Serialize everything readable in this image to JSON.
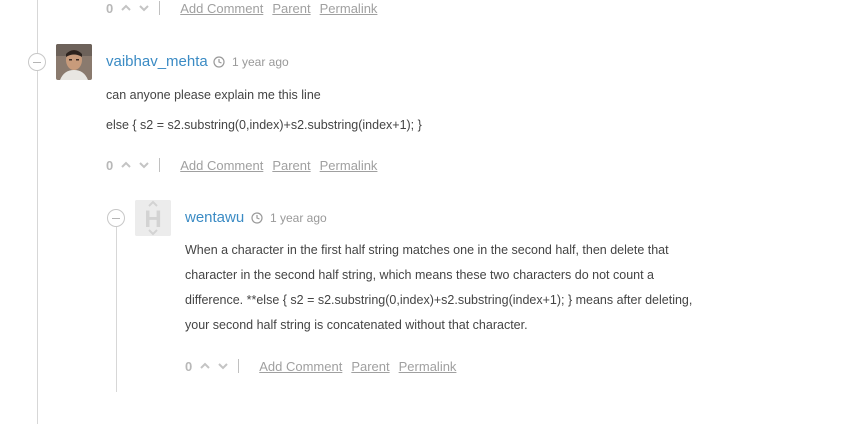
{
  "top_actions": {
    "count": "0",
    "add_comment": "Add Comment",
    "parent": "Parent",
    "permalink": "Permalink"
  },
  "comment1": {
    "author": "vaibhav_mehta",
    "time": "1 year ago",
    "line1": "can anyone please explain me this line",
    "line2": "else { s2 = s2.substring(0,index)+s2.substring(index+1); }",
    "actions": {
      "count": "0",
      "add_comment": "Add Comment",
      "parent": "Parent",
      "permalink": "Permalink"
    }
  },
  "comment2": {
    "author": "wentawu",
    "time": "1 year ago",
    "avatar_letter": "H",
    "lines": [
      "When a character in the first half string matches one in the second half, then delete that",
      "character in the second half string, which means these two characters do not count a",
      "difference. **else { s2 = s2.substring(0,index)+s2.substring(index+1); } means after deleting,",
      "your second half string is concatenated without that character."
    ],
    "actions": {
      "count": "0",
      "add_comment": "Add Comment",
      "parent": "Parent",
      "permalink": "Permalink"
    }
  },
  "colors": {
    "author": "#3b8bc4",
    "thread_line": "#d7d7d7"
  }
}
